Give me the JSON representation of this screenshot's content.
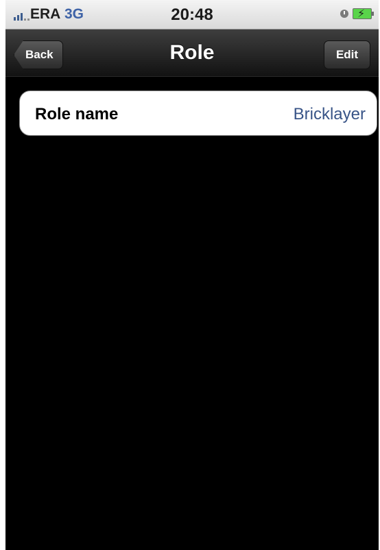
{
  "status_bar": {
    "carrier": "ERA",
    "network": "3G",
    "time": "20:48"
  },
  "nav": {
    "title": "Role",
    "back_label": "Back",
    "edit_label": "Edit"
  },
  "table": {
    "rows": [
      {
        "label": "Role name",
        "value": "Bricklayer"
      }
    ]
  },
  "colors": {
    "value_text": "#385487",
    "network_text": "#3f63a7",
    "background": "#000000"
  }
}
